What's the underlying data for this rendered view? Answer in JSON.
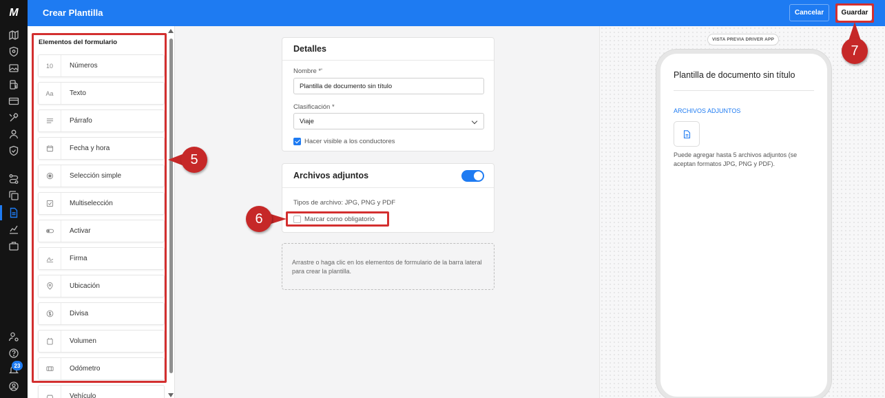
{
  "app": {
    "logo": "M",
    "title": "Crear Plantilla",
    "notification_count": "23",
    "accent_color": "#1e7bf2",
    "annotation_color": "#d32f2f"
  },
  "header": {
    "cancel_label": "Cancelar",
    "save_label": "Guardar"
  },
  "rail": {
    "icons": [
      "map-icon",
      "shield-icon",
      "image-icon",
      "fuel-icon",
      "card-icon",
      "tools-icon",
      "person-icon",
      "shield-check-icon",
      "route-icon",
      "copy-icon",
      "document-icon",
      "chart-icon",
      "briefcase-icon",
      "user-settings-icon",
      "help-icon",
      "bell-icon",
      "account-icon"
    ],
    "active": "document-icon"
  },
  "sidebar": {
    "heading": "Elementos del formulario",
    "items": [
      {
        "icon_text": "10",
        "label": "Números",
        "icon": "number-icon"
      },
      {
        "icon_text": "Aa",
        "label": "Texto",
        "icon": "text-icon"
      },
      {
        "icon_text": "",
        "label": "Párrafo",
        "icon": "paragraph-icon"
      },
      {
        "icon_text": "",
        "label": "Fecha y hora",
        "icon": "calendar-icon"
      },
      {
        "icon_text": "",
        "label": "Selección simple",
        "icon": "radio-icon"
      },
      {
        "icon_text": "",
        "label": "Multiselección",
        "icon": "checkbox-icon"
      },
      {
        "icon_text": "",
        "label": "Activar",
        "icon": "toggle-icon"
      },
      {
        "icon_text": "",
        "label": "Firma",
        "icon": "signature-icon"
      },
      {
        "icon_text": "",
        "label": "Ubicación",
        "icon": "location-pin-icon"
      },
      {
        "icon_text": "",
        "label": "Divisa",
        "icon": "currency-icon"
      },
      {
        "icon_text": "",
        "label": "Volumen",
        "icon": "volume-icon"
      },
      {
        "icon_text": "",
        "label": "Odómetro",
        "icon": "odometer-icon"
      },
      {
        "icon_text": "",
        "label": "Vehículo",
        "icon": "vehicle-icon"
      }
    ]
  },
  "details": {
    "title": "Detalles",
    "name_label": "Nombre *'",
    "name_value": "Plantilla de documento sin título",
    "classification_label": "Clasificación *",
    "classification_value": "Viaje",
    "visible_checkbox_label": "Hacer visible a los conductores",
    "visible_checked": true
  },
  "attachments": {
    "title": "Archivos adjuntos",
    "enabled": true,
    "file_types": "Tipos de archivo: JPG, PNG y PDF",
    "required_label": "Marcar como obligatorio",
    "required_checked": false
  },
  "dropzone": {
    "text": "Arrastre o haga clic en los elementos de formulario de la barra lateral para crear la plantilla."
  },
  "preview": {
    "pill": "VISTA PREVIA DRIVER APP",
    "title": "Plantilla de documento sin título",
    "section": "ARCHIVOS ADJUNTOS",
    "help": "Puede agregar hasta 5 archivos adjuntos (se aceptan formatos JPG, PNG y PDF)."
  },
  "callouts": {
    "c5": "5",
    "c6": "6",
    "c7": "7"
  }
}
